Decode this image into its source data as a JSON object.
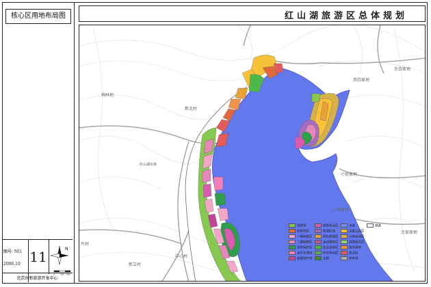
{
  "sheet_title": "核心区用地布局图",
  "main_title": "红山湖旅游区总体规划",
  "title_block": {
    "drawing_no_label": "图号: NO.",
    "drawing_no": "11",
    "date": "2006.10",
    "organization": "北京创新旅游开发中心",
    "north_label": "N",
    "scale_ticks": [
      "0",
      "300",
      "600"
    ]
  },
  "place_names": {
    "yanglindi": "梅林地",
    "xinbeicun": "新北村",
    "xibaijiadi": "西白家地",
    "dongbaijiadi": "东白家地",
    "xiaoguanjiadi1": "小官家地",
    "xiaoguanjiadi2": "小官家地",
    "dagunjiadi": "大官家地",
    "zhongxincun": "中心村",
    "xinlicun": "新立村",
    "zhuangcun": "片村",
    "center_label": "红山湖水库"
  },
  "legend": {
    "items": [
      {
        "label": "湖滨带",
        "color": "#86c850"
      },
      {
        "label": "度假村区",
        "color": "#e06a3c"
      },
      {
        "label": "一期别墅区",
        "color": "#f2a6c8"
      },
      {
        "label": "二期别墅区",
        "color": "#e487b9"
      },
      {
        "label": "湿地保护区",
        "color": "#2e9e4a"
      },
      {
        "label": "高尔夫球场",
        "color": "#f27fb8"
      },
      {
        "label": "度假地产带",
        "color": "#c3459a"
      },
      {
        "label": "度假商业区",
        "color": "#d85db0"
      },
      {
        "label": "管理区域",
        "color": "#a66cc2"
      },
      {
        "label": "酒店度假区",
        "color": "#e9a13a"
      },
      {
        "label": "运动健身区",
        "color": "#b85a96"
      },
      {
        "label": "生态湿地区",
        "color": "#4db84a"
      },
      {
        "label": "体育休闲区",
        "color": "#5ea85a"
      },
      {
        "label": "主题",
        "color": "#3a8c3c"
      },
      {
        "label": "水域",
        "color": "#7a8cf0"
      },
      {
        "label": "主题公园区",
        "color": "#f7c23a"
      },
      {
        "label": "山地运动区",
        "color": "#d4b14a"
      },
      {
        "label": "游憩观光区",
        "color": "#9ad27a"
      },
      {
        "label": "服务基地",
        "color": "#f0924a"
      },
      {
        "label": "商业街",
        "color": "#e45b5b"
      },
      {
        "label": "停车场",
        "color": "#b0b0b0"
      },
      {
        "label": "铁路",
        "color": "#ffffff"
      }
    ]
  },
  "colors": {
    "lake": "#6478ee",
    "lake_edge": "#3f4fcc",
    "road": "#9a9a9a",
    "contour": "#d6d6d6"
  }
}
